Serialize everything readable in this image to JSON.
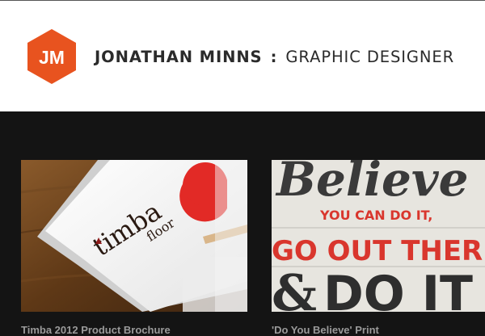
{
  "header": {
    "logo_text": "JM",
    "title_name": "JONATHAN MINNS",
    "title_separator": ":",
    "title_role": "GRAPHIC DESIGNER",
    "logo_color": "#e8531f"
  },
  "portfolio": {
    "items": [
      {
        "thumbnail_text": "timba",
        "thumbnail_subtext": "floor",
        "caption": "Timba 2012 Product Brochure"
      },
      {
        "thumbnail_lines": [
          "Believe",
          "YOU CAN DO IT,",
          "GO OUT THERE",
          "&",
          "DO IT"
        ],
        "caption": "'Do You Believe' Print"
      }
    ]
  }
}
